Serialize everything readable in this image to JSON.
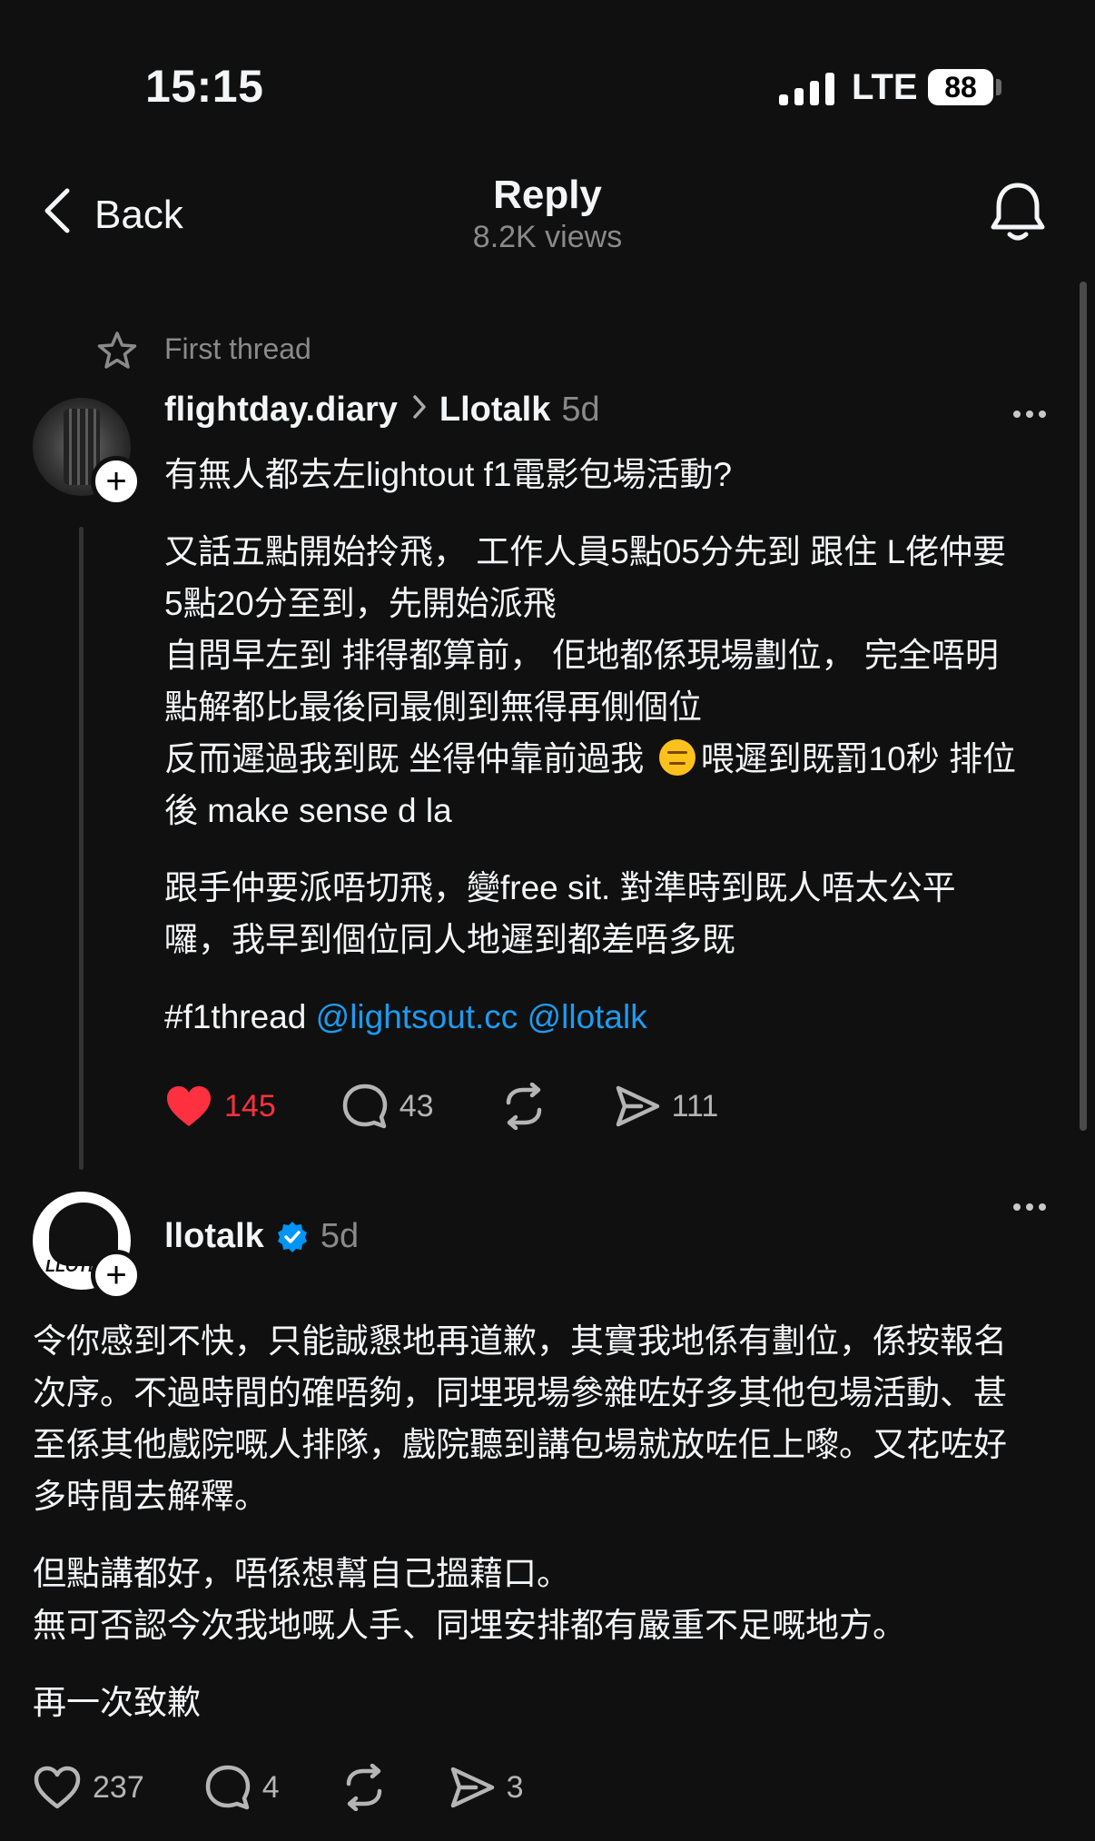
{
  "status_bar": {
    "time": "15:15",
    "network": "LTE",
    "battery": "88"
  },
  "header": {
    "back_label": "Back",
    "title": "Reply",
    "views": "8.2K views"
  },
  "thread_label": "First thread",
  "post1": {
    "username": "flightday.diary",
    "community": "Llotalk",
    "age": "5d",
    "lines": [
      "有無人都去左lightout f1電影包場活動?",
      "又話五點開始拎飛， 工作人員5點05分先到 跟住 L佬仲要",
      "5點20分至到，先開始派飛",
      "自問早左到 排得都算前， 佢地都係現場劃位， 完全唔明",
      "點解都比最後同最側到無得再側個位",
      "反而遲過我到既 坐得仲靠前過我",
      "喂遲到既罰10秒 排位",
      "後 make sense d la",
      "跟手仲要派唔切飛，變free sit. 對準時到既人唔太公平",
      "囉，我早到個位同人地遲到都差唔多既",
      "#f1thread",
      "@lightsout.cc",
      "@llotalk"
    ],
    "likes": "145",
    "comments": "43",
    "shares": "111"
  },
  "post2": {
    "username": "llotalk",
    "age": "5d",
    "avatar_text": "LLOTL",
    "lines": [
      "令你感到不快，只能誠懇地再道歉，其實我地係有劃位，係按報名",
      "次序。不過時間的確唔夠，同埋現場參雜咗好多其他包場活動、甚",
      "至係其他戲院嘅人排隊，戲院聽到講包場就放咗佢上嚟。又花咗好",
      "多時間去解釋。",
      "但點講都好，唔係想幫自己搵藉口。",
      "無可否認今次我地嘅人手、同埋安排都有嚴重不足嘅地方。",
      "再一次致歉"
    ],
    "likes": "237",
    "comments": "4",
    "shares": "3"
  },
  "colors": {
    "background": "#101010",
    "like_red": "#ff3040",
    "link_blue": "#1d9bf0",
    "verified_blue": "#0095f6"
  }
}
